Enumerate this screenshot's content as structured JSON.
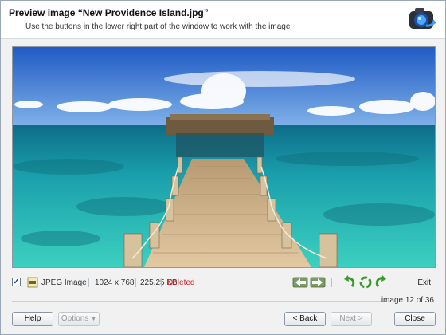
{
  "header": {
    "title": "Preview image “New Providence Island.jpg”",
    "subtitle": "Use the buttons in the lower right part of the window to work with the image",
    "logo_icon": "camera-recover-icon"
  },
  "preview": {
    "image_icon": "photo-pier-beach"
  },
  "info": {
    "checkbox_checked": true,
    "checkbox_mark": "✓",
    "file_type": "JPEG Image",
    "file_type_icon": "jpeg-file-icon",
    "dimensions": "1024 x 768",
    "size": "225.25 KB",
    "status": "Deleted",
    "status_color": "#d22020"
  },
  "toolbar": {
    "tools": [
      {
        "name": "prev-image-button",
        "icon": "arrow-left-icon"
      },
      {
        "name": "next-image-button",
        "icon": "arrow-right-icon"
      },
      {
        "name": "rotate-left-button",
        "icon": "rotate-left-icon"
      },
      {
        "name": "rotate-center-button",
        "icon": "recycle-icon"
      },
      {
        "name": "rotate-right-button",
        "icon": "rotate-right-icon"
      }
    ],
    "exit_label": "Exit"
  },
  "page_count": "image 12 of 36",
  "footer": {
    "help_label": "Help",
    "options_label": "Options",
    "back_label": "< Back",
    "next_label": "Next >",
    "close_label": "Close"
  },
  "colors": {
    "sky": "#2f6fd0",
    "sea": "#1fb0b8",
    "accent_green": "#3a9a2a"
  }
}
